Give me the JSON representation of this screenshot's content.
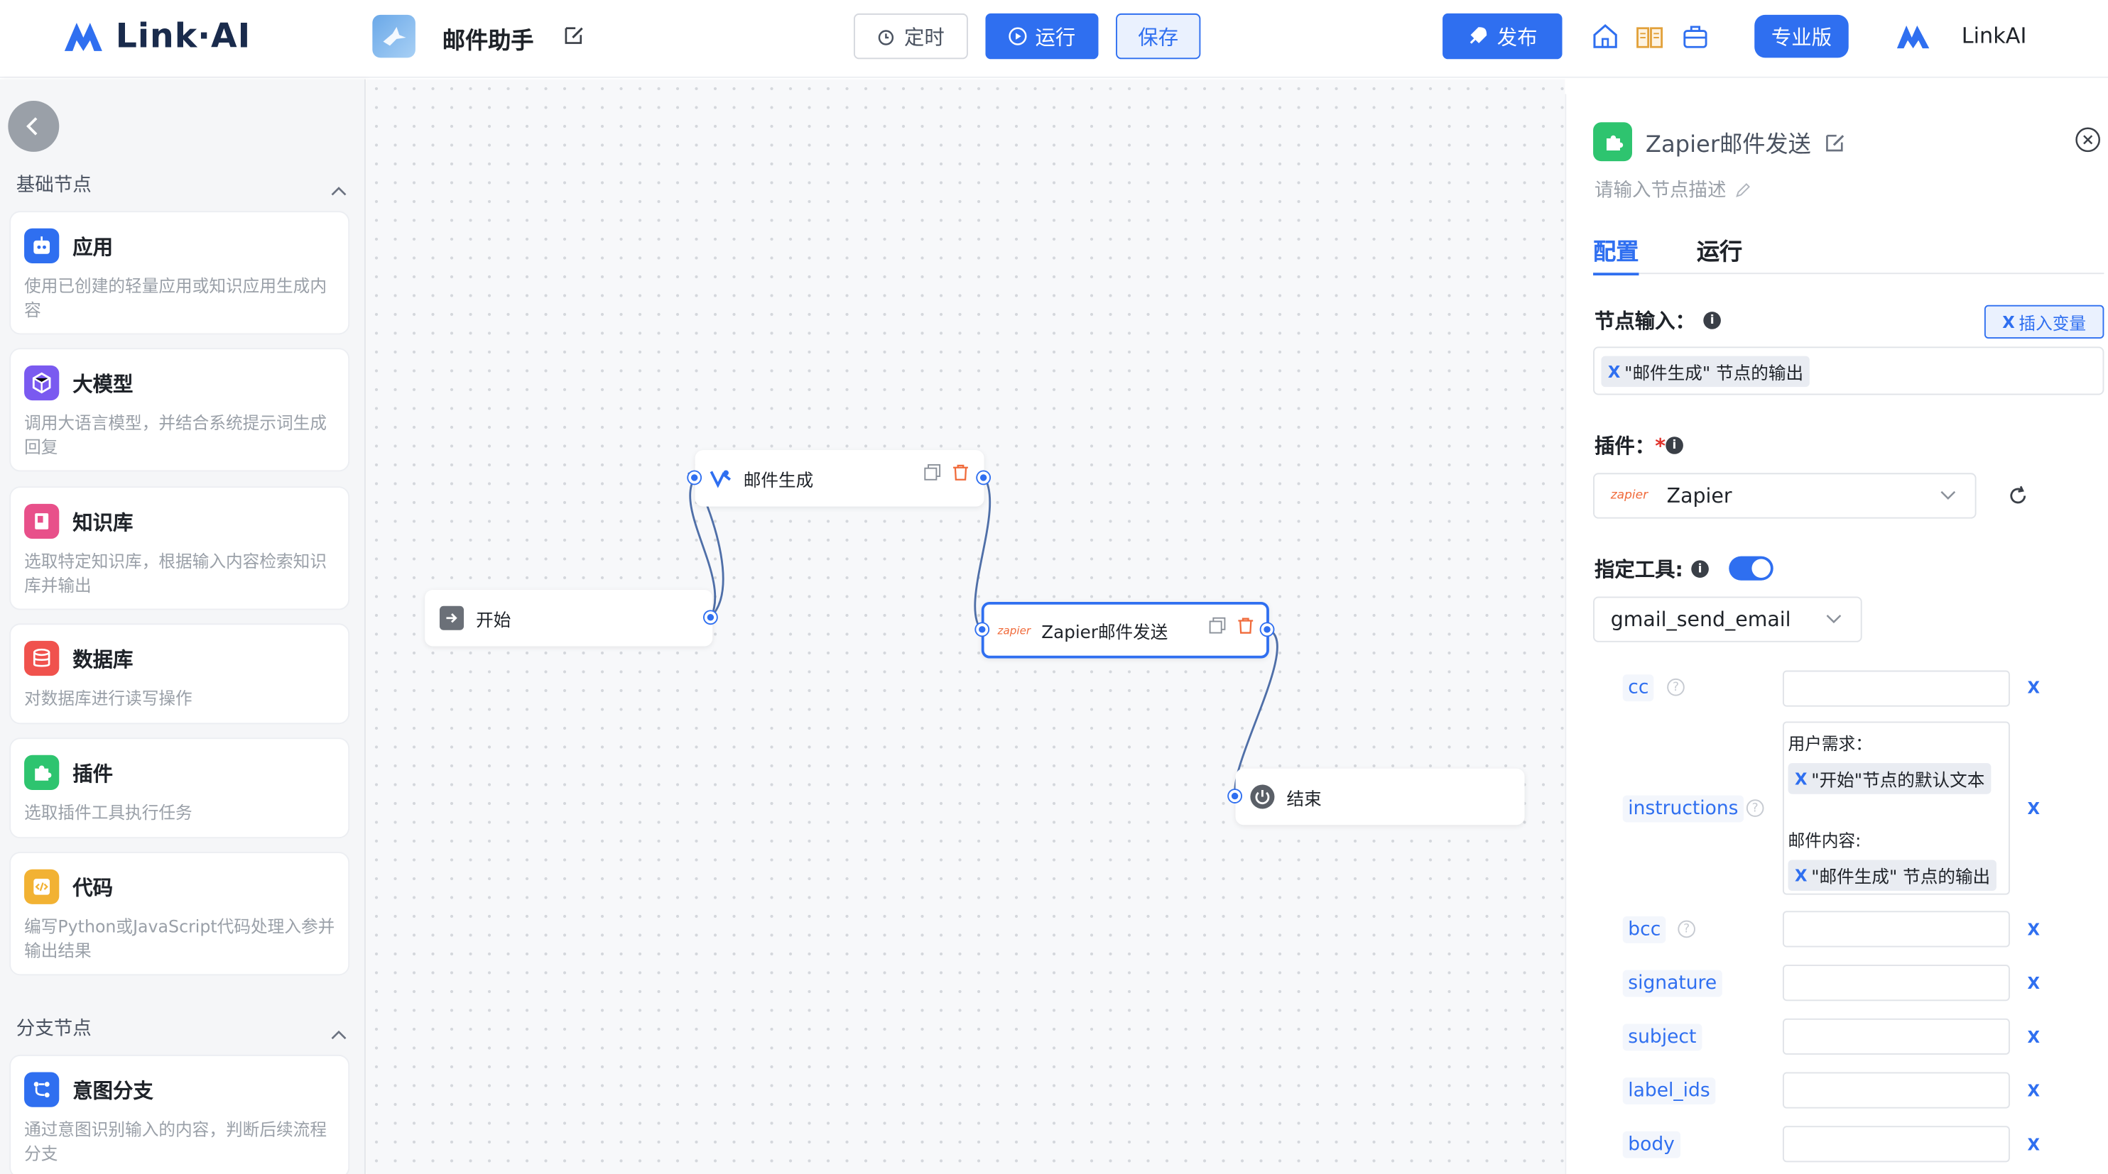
{
  "header": {
    "logo_text": "Link·AI",
    "app_name": "邮件助手",
    "timer_label": "定时",
    "run_label": "运行",
    "save_label": "保存",
    "publish_label": "发布",
    "pro_label": "专业版",
    "user_name": "LinkAI"
  },
  "sidebar": {
    "basic_section": "基础节点",
    "branch_section": "分支节点",
    "items": [
      {
        "title": "应用",
        "desc": "使用已创建的轻量应用或知识应用生成内容"
      },
      {
        "title": "大模型",
        "desc": "调用大语言模型，并结合系统提示词生成回复"
      },
      {
        "title": "知识库",
        "desc": "选取特定知识库，根据输入内容检索知识库并输出"
      },
      {
        "title": "数据库",
        "desc": "对数据库进行读写操作"
      },
      {
        "title": "插件",
        "desc": "选取插件工具执行任务"
      },
      {
        "title": "代码",
        "desc": "编写Python或JavaScript代码处理入参并输出结果"
      }
    ],
    "branch_items": [
      {
        "title": "意图分支",
        "desc": "通过意图识别输入的内容，判断后续流程分支"
      }
    ]
  },
  "canvas": {
    "nodes": {
      "start": "开始",
      "mail_gen": "邮件生成",
      "zapier_send": "Zapier邮件发送",
      "end": "结束"
    }
  },
  "panel": {
    "title": "Zapier邮件发送",
    "desc_placeholder": "请输入节点描述",
    "tab_config": "配置",
    "tab_run": "运行",
    "node_input_label": "节点输入：",
    "insert_var_label": "插入变量",
    "node_input_tag": "\"邮件生成\" 节点的输出",
    "plugin_label": "插件：",
    "plugin_required": "*",
    "plugin_value": "Zapier",
    "plugin_logo_text": "zapier",
    "tool_label": "指定工具:",
    "tool_value": "gmail_send_email",
    "params": {
      "cc": "cc",
      "instructions": "instructions",
      "bcc": "bcc",
      "signature": "signature",
      "subject": "subject",
      "label_ids": "label_ids",
      "body": "body"
    },
    "instructions_text": {
      "line1": "用户需求：",
      "tag1": "\"开始\"节点的默认文本",
      "line2": "邮件内容:",
      "tag2": "\"邮件生成\" 节点的输出"
    },
    "var_marker": "X"
  },
  "colors": {
    "accent": "#2f6ff0",
    "danger": "#f06a3a",
    "plugin_green": "#2ec46f"
  }
}
